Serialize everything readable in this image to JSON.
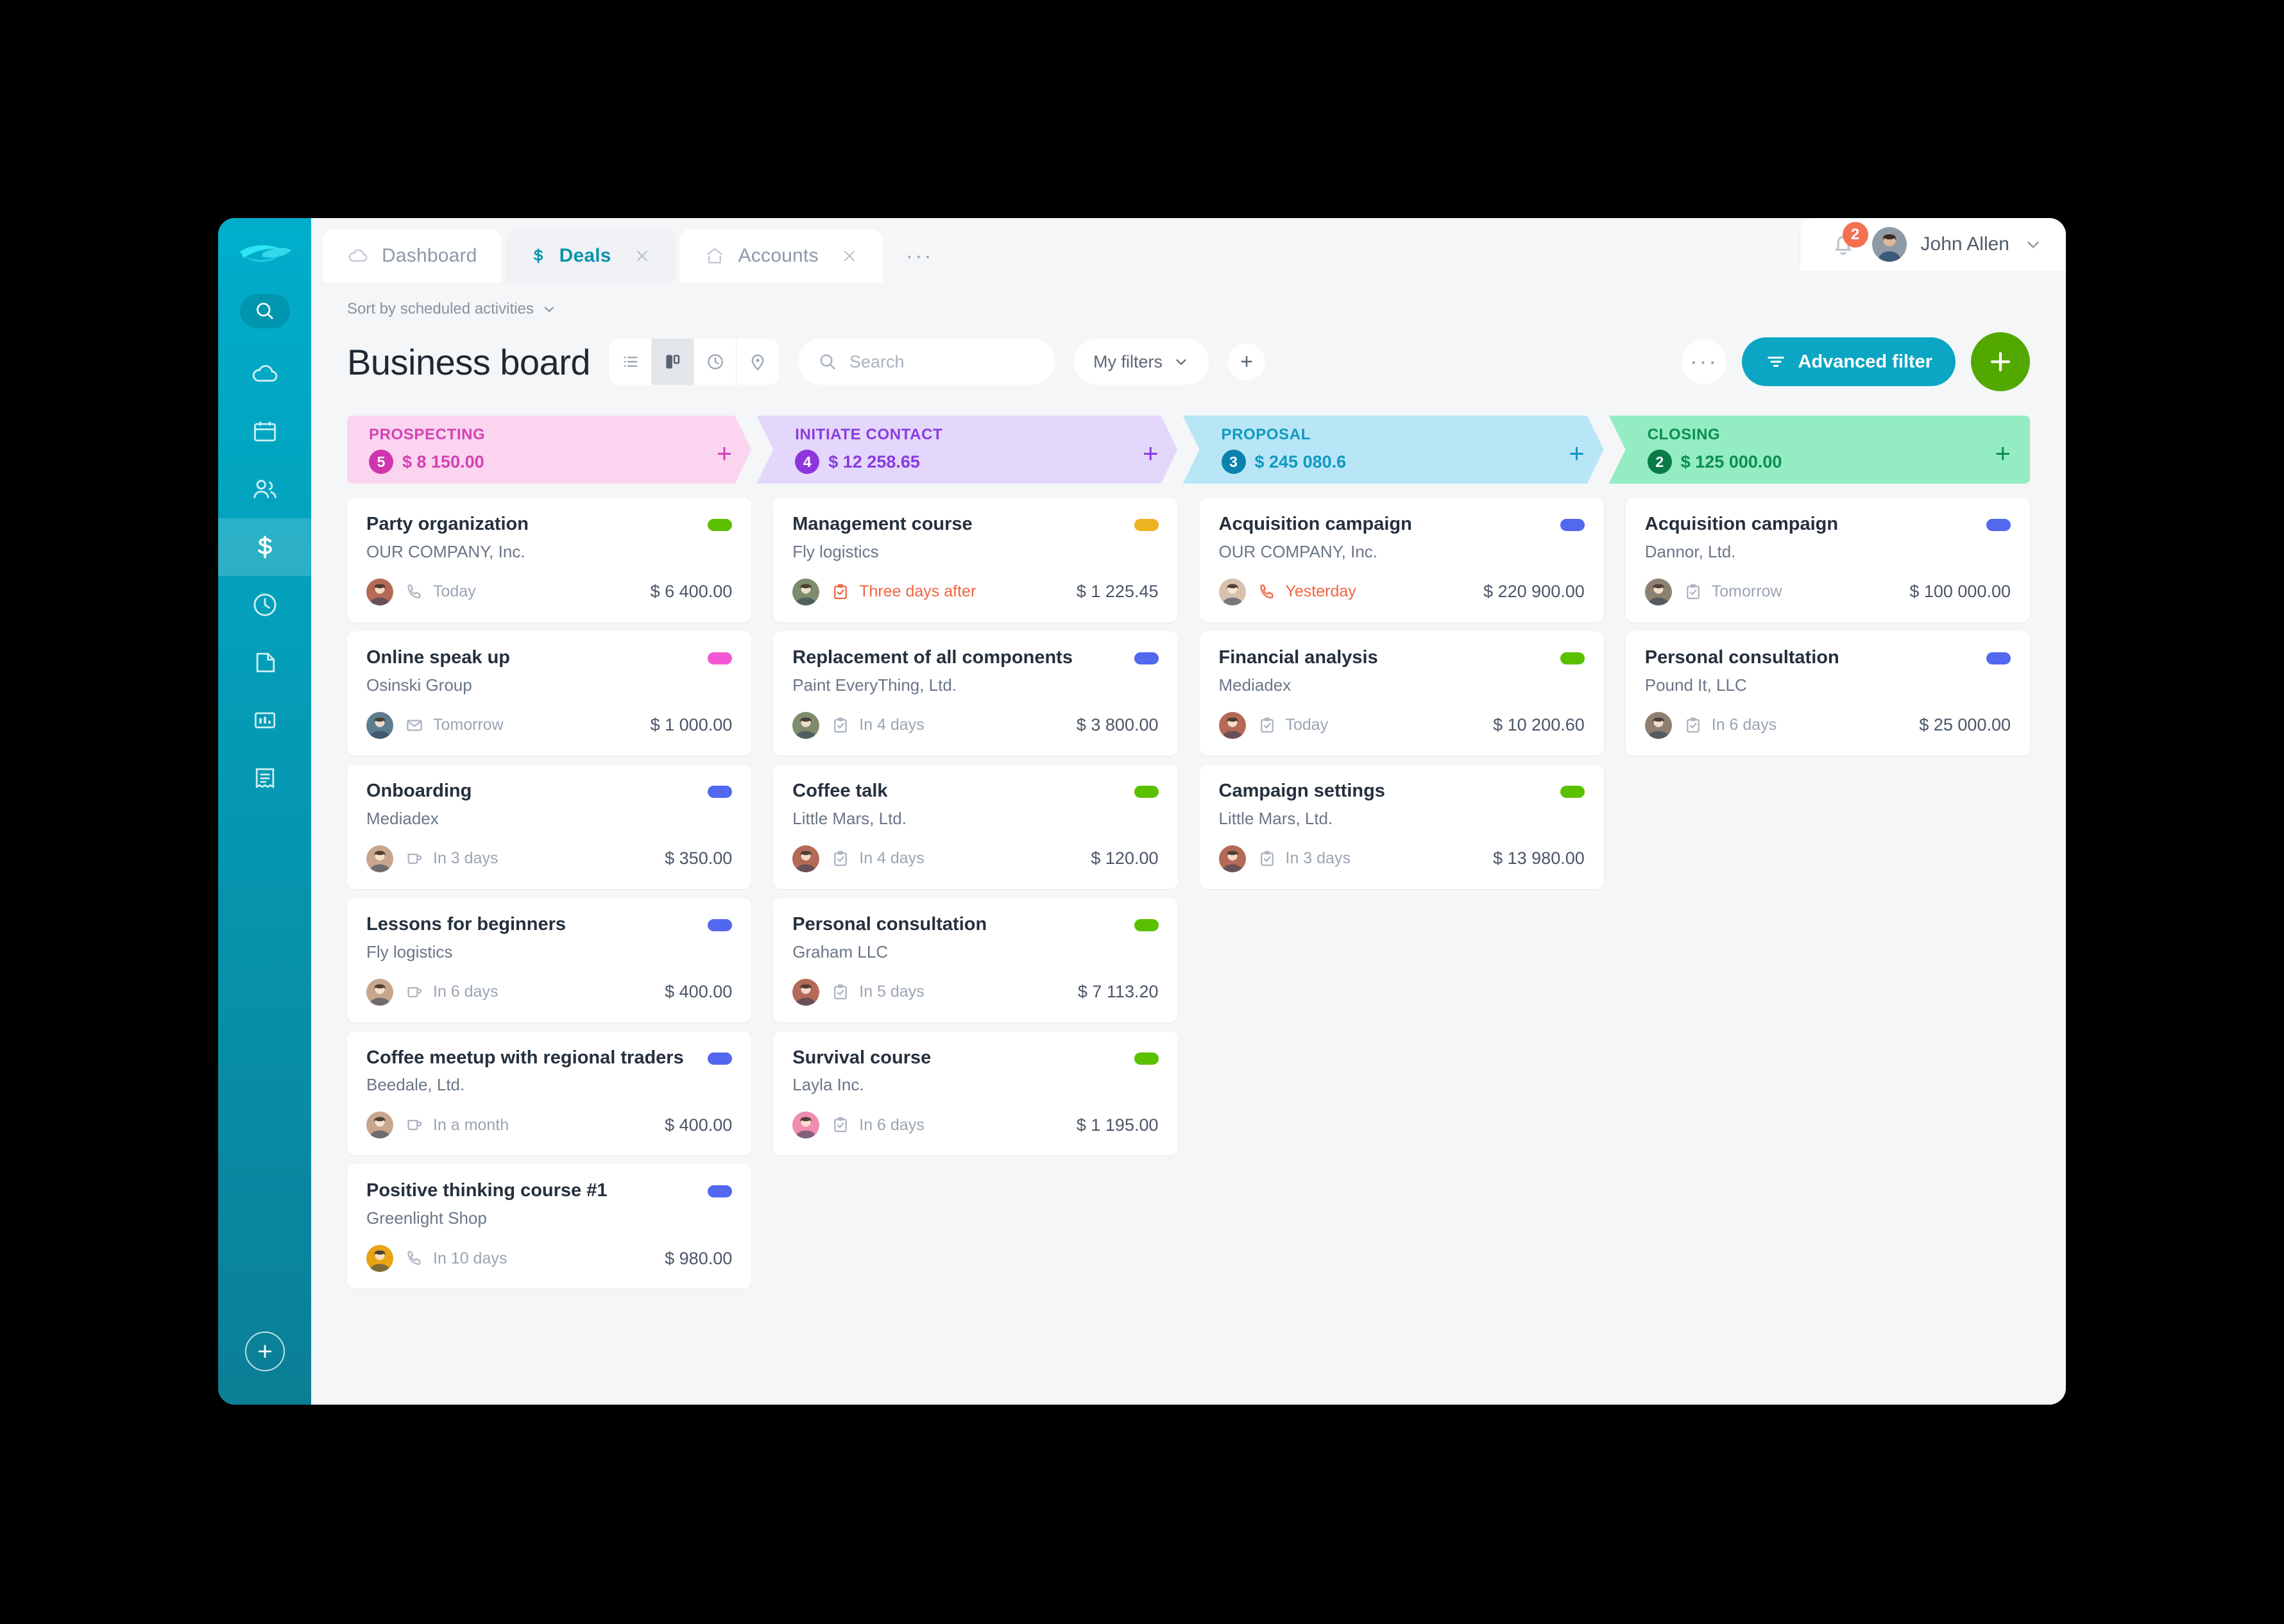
{
  "app": {
    "tabs": [
      {
        "label": "Dashboard",
        "icon": "cloud-icon",
        "active": false,
        "closable": false
      },
      {
        "label": "Deals",
        "icon": "dollar-icon",
        "active": true,
        "closable": true
      },
      {
        "label": "Accounts",
        "icon": "home-icon",
        "active": false,
        "closable": true
      }
    ],
    "tabs_overflow": "···",
    "user": {
      "name": "John Allen",
      "notification_count": "2"
    }
  },
  "sidebar": {
    "items": [
      {
        "name": "search-icon",
        "active": false
      },
      {
        "name": "cloud-icon",
        "active": false
      },
      {
        "name": "calendar-icon",
        "active": false
      },
      {
        "name": "contacts-icon",
        "active": false
      },
      {
        "name": "deals-dollar-icon",
        "active": true
      },
      {
        "name": "clock-icon",
        "active": false
      },
      {
        "name": "document-icon",
        "active": false
      },
      {
        "name": "analytics-icon",
        "active": false
      },
      {
        "name": "invoice-icon",
        "active": false
      }
    ]
  },
  "toolbar": {
    "sort_label": "Sort by scheduled activities",
    "board_title": "Business board",
    "views": [
      {
        "name": "list-view",
        "active": false
      },
      {
        "name": "kanban-view",
        "active": true
      },
      {
        "name": "timeline-view",
        "active": false
      },
      {
        "name": "map-view",
        "active": false
      }
    ],
    "search_placeholder": "Search",
    "search_value": "",
    "my_filters_label": "My filters",
    "add_filter_label": "+",
    "more_label": "···",
    "advanced_filter_label": "Advanced filter",
    "add_deal_label": "+",
    "accent_color": "#0aa6c4",
    "add_button_color": "#53a800"
  },
  "board": {
    "columns": [
      {
        "name": "PROSPECTING",
        "count": "5",
        "sum": "$ 8 150.00",
        "bg": "#fbd5ef",
        "fg": "#d63fb5",
        "badge_bg": "#cf35ad",
        "add_label": "+",
        "cards": [
          {
            "title": "Party organization",
            "company": "OUR COMPANY, Inc.",
            "activity_icon": "phone-icon",
            "activity": "Today",
            "overdue": false,
            "amount": "$ 6 400.00",
            "pill": "#5ac000",
            "avatar": "#b56a57"
          },
          {
            "title": "Online speak up",
            "company": "Osinski Group",
            "activity_icon": "email-icon",
            "activity": "Tomorrow",
            "overdue": false,
            "amount": "$ 1 000.00",
            "pill": "#f358d4",
            "avatar": "#5c7d8f"
          },
          {
            "title": "Onboarding",
            "company": "Mediadex",
            "activity_icon": "meeting-icon",
            "activity": "In 3 days",
            "overdue": false,
            "amount": "$ 350.00",
            "pill": "#5168ef",
            "avatar": "#c7a68d"
          },
          {
            "title": "Lessons for beginners",
            "company": "Fly logistics",
            "activity_icon": "meeting-icon",
            "activity": "In 6 days",
            "overdue": false,
            "amount": "$ 400.00",
            "pill": "#5168ef",
            "avatar": "#c7a68d"
          },
          {
            "title": "Coffee meetup with regional traders",
            "company": "Beedale, Ltd.",
            "activity_icon": "meeting-icon",
            "activity": "In a month",
            "overdue": false,
            "amount": "$ 400.00",
            "pill": "#5168ef",
            "avatar": "#c7a68d"
          },
          {
            "title": "Positive thinking course #1",
            "company": "Greenlight Shop",
            "activity_icon": "phone-icon",
            "activity": "In 10 days",
            "overdue": false,
            "amount": "$ 980.00",
            "pill": "#5168ef",
            "avatar": "#e8a417"
          }
        ]
      },
      {
        "name": "INITIATE CONTACT",
        "count": "4",
        "sum": "$ 12 258.65",
        "bg": "#e3d8fb",
        "fg": "#8a3ae0",
        "badge_bg": "#8f35dd",
        "add_label": "+",
        "cards": [
          {
            "title": "Management course",
            "company": "Fly logistics",
            "activity_icon": "task-icon",
            "activity": "Three days after",
            "overdue": true,
            "amount": "$ 1 225.45",
            "pill": "#edb21f",
            "avatar": "#7f8c6c"
          },
          {
            "title": "Replacement of all components",
            "company": "Paint EveryThing, Ltd.",
            "activity_icon": "task-icon",
            "activity": "In 4 days",
            "overdue": false,
            "amount": "$ 3 800.00",
            "pill": "#5168ef",
            "avatar": "#7f8c6c"
          },
          {
            "title": "Coffee talk",
            "company": "Little Mars, Ltd.",
            "activity_icon": "task-icon",
            "activity": "In 4 days",
            "overdue": false,
            "amount": "$ 120.00",
            "pill": "#5ac000",
            "avatar": "#b56a57"
          },
          {
            "title": "Personal consultation",
            "company": "Graham LLC",
            "activity_icon": "task-icon",
            "activity": "In 5 days",
            "overdue": false,
            "amount": "$ 7 113.20",
            "pill": "#5ac000",
            "avatar": "#b56a57"
          },
          {
            "title": "Survival course",
            "company": "Layla Inc.",
            "activity_icon": "task-icon",
            "activity": "In 6 days",
            "overdue": false,
            "amount": "$ 1 195.00",
            "pill": "#5ac000",
            "avatar": "#f08cb0"
          }
        ]
      },
      {
        "name": "PROPOSAL",
        "count": "3",
        "sum": "$ 245 080.6",
        "bg": "#b9e6f7",
        "fg": "#0e9ac0",
        "badge_bg": "#0b82ae",
        "add_label": "+",
        "cards": [
          {
            "title": "Acquisition campaign",
            "company": "OUR COMPANY, Inc.",
            "activity_icon": "phone-icon",
            "activity": "Yesterday",
            "overdue": true,
            "amount": "$ 220 900.00",
            "pill": "#5168ef",
            "avatar": "#d8c2ae"
          },
          {
            "title": "Financial analysis",
            "company": "Mediadex",
            "activity_icon": "task-icon",
            "activity": "Today",
            "overdue": false,
            "amount": "$ 10 200.60",
            "pill": "#5ac000",
            "avatar": "#b56a57"
          },
          {
            "title": "Campaign settings",
            "company": "Little Mars, Ltd.",
            "activity_icon": "task-icon",
            "activity": "In 3 days",
            "overdue": false,
            "amount": "$ 13 980.00",
            "pill": "#5ac000",
            "avatar": "#b56a57"
          }
        ]
      },
      {
        "name": "CLOSING",
        "count": "2",
        "sum": "$ 125 000.00",
        "bg": "#94ecc2",
        "fg": "#0b8d52",
        "badge_bg": "#0a7a47",
        "add_label": "+",
        "cards": [
          {
            "title": "Acquisition campaign",
            "company": "Dannor, Ltd.",
            "activity_icon": "task-icon",
            "activity": "Tomorrow",
            "overdue": false,
            "amount": "$ 100 000.00",
            "pill": "#5168ef",
            "avatar": "#8d8070"
          },
          {
            "title": "Personal consultation",
            "company": "Pound It, LLC",
            "activity_icon": "task-icon",
            "activity": "In 6 days",
            "overdue": false,
            "amount": "$ 25 000.00",
            "pill": "#5168ef",
            "avatar": "#8d8070"
          }
        ]
      }
    ]
  }
}
